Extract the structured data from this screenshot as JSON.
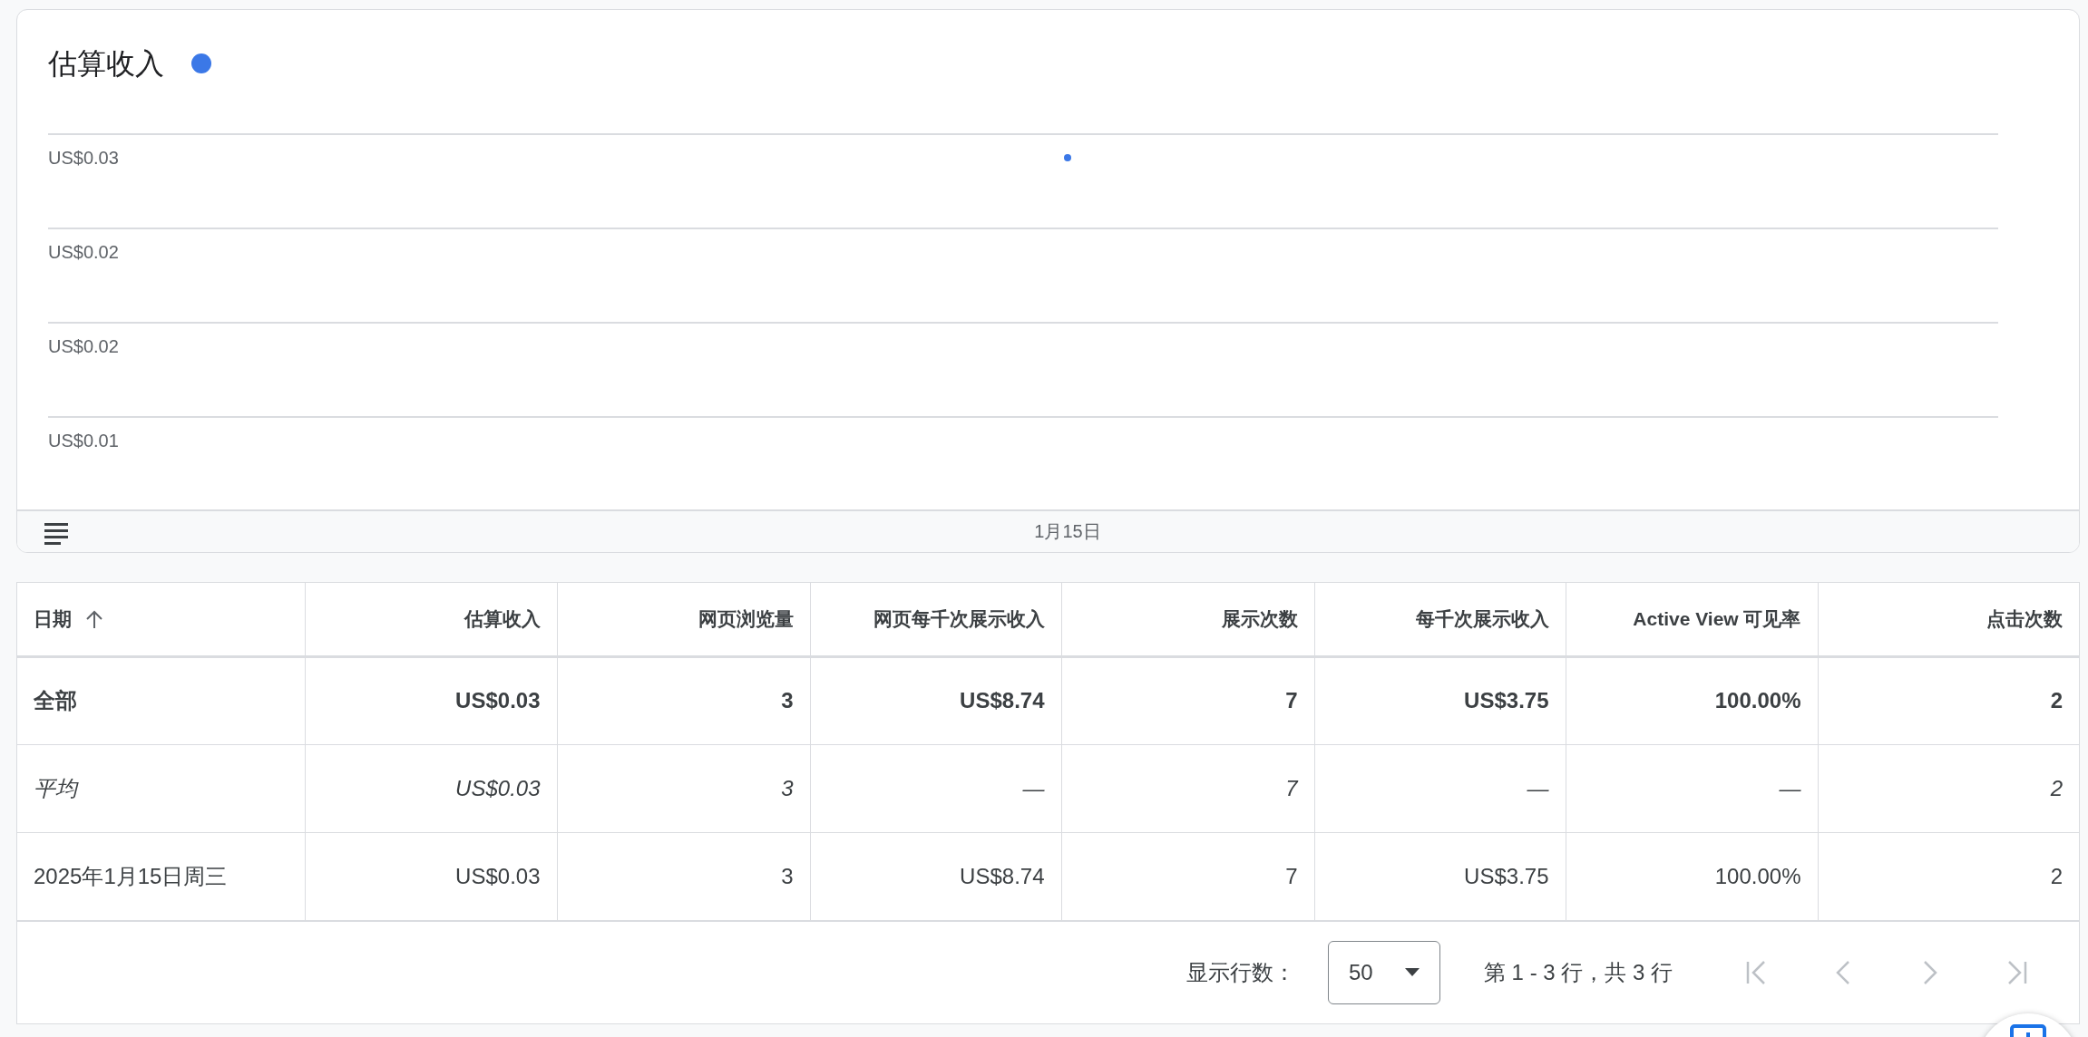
{
  "chart_card": {
    "title": "估算收入",
    "y_axis_labels": [
      "US$0.03",
      "US$0.02",
      "US$0.02",
      "US$0.01"
    ],
    "x_axis_labels": [
      "1月15日"
    ]
  },
  "table": {
    "columns": [
      {
        "label": "日期",
        "sorted": true
      },
      {
        "label": "估算收入",
        "sorted": false
      },
      {
        "label": "网页浏览量",
        "sorted": false
      },
      {
        "label": "网页每千次展示收入",
        "sorted": false
      },
      {
        "label": "展示次数",
        "sorted": false
      },
      {
        "label": "每千次展示收入",
        "sorted": false
      },
      {
        "label": "Active View 可见率",
        "sorted": false
      },
      {
        "label": "点击次数",
        "sorted": false
      }
    ],
    "rows": [
      {
        "kind": "total",
        "cells": [
          "全部",
          "US$0.03",
          "3",
          "US$8.74",
          "7",
          "US$3.75",
          "100.00%",
          "2"
        ]
      },
      {
        "kind": "average",
        "cells": [
          "平均",
          "US$0.03",
          "3",
          "—",
          "7",
          "—",
          "—",
          "2"
        ]
      },
      {
        "kind": "data",
        "cells": [
          "2025年1月15日周三",
          "US$0.03",
          "3",
          "US$8.74",
          "7",
          "US$3.75",
          "100.00%",
          "2"
        ]
      }
    ]
  },
  "pagination": {
    "rows_per_page_label": "显示行数：",
    "rows_per_page": "50",
    "range": "第 1 - 3 行，共 3 行",
    "buttons": [
      {
        "kind": "first",
        "disabled": true
      },
      {
        "kind": "previous",
        "disabled": true
      },
      {
        "kind": "next",
        "disabled": true
      },
      {
        "kind": "last",
        "disabled": true
      }
    ]
  }
}
